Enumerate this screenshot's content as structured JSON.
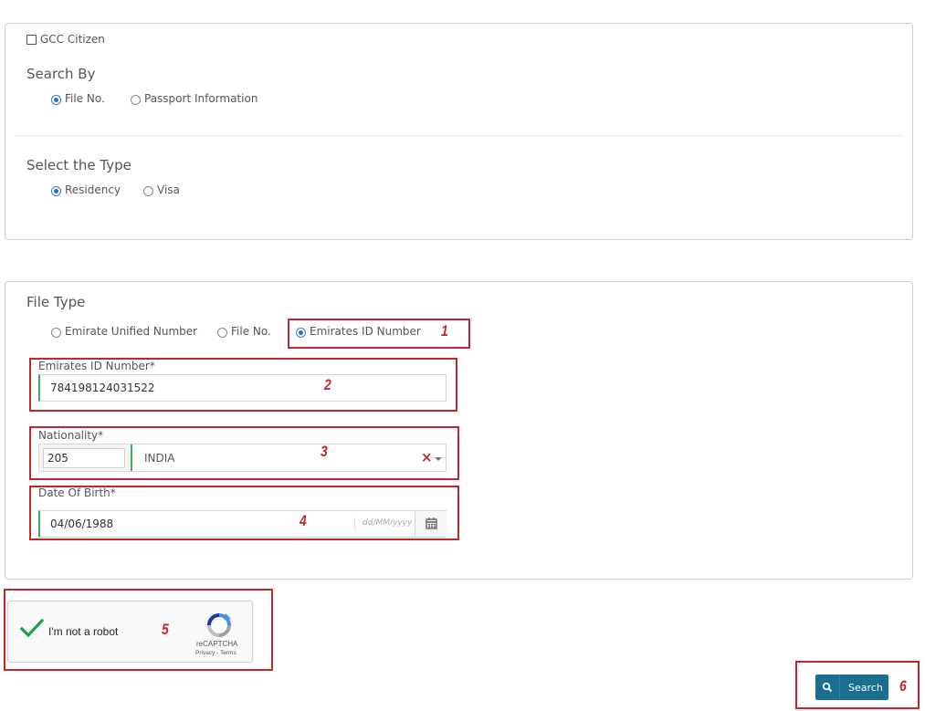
{
  "search_panel": {
    "gcc_citizen_label": "GCC Citizen",
    "search_by_title": "Search By",
    "search_by_options": [
      "File No.",
      "Passport Information"
    ],
    "search_by_selected": "File No.",
    "type_title": "Select the Type",
    "type_options": [
      "Residency",
      "Visa"
    ],
    "type_selected": "Residency"
  },
  "file_panel": {
    "title": "File Type",
    "file_type_options": [
      "Emirate Unified Number",
      "File No.",
      "Emirates ID Number"
    ],
    "file_type_selected": "Emirates ID Number",
    "emirates_id": {
      "label": "Emirates ID Number*",
      "value": "784198124031522"
    },
    "nationality": {
      "label": "Nationality*",
      "code": "205",
      "name": "INDIA"
    },
    "dob": {
      "label": "Date Of Birth*",
      "value": "04/06/1988",
      "placeholder": "dd/MM/yyyy"
    }
  },
  "captcha": {
    "label": "I'm not a robot",
    "brand": "reCAPTCHA",
    "privacy": "Privacy",
    "separator": "-",
    "terms": "Terms",
    "checked": true
  },
  "search_button": {
    "label": "Search"
  },
  "annotations": [
    "1",
    "2",
    "3",
    "4",
    "5",
    "6"
  ],
  "colors": {
    "annotation": "#c1272d",
    "valid_border": "#3cab5e",
    "radio_selected": "#2d6bc4",
    "button_bg": "#1a6f90"
  },
  "icons": {
    "calendar": "calendar-icon",
    "clear": "clear-icon",
    "dropdown": "chevron-down-icon",
    "search": "search-icon",
    "captcha_check": "checkmark-icon",
    "captcha_logo": "recaptcha-logo-icon"
  }
}
